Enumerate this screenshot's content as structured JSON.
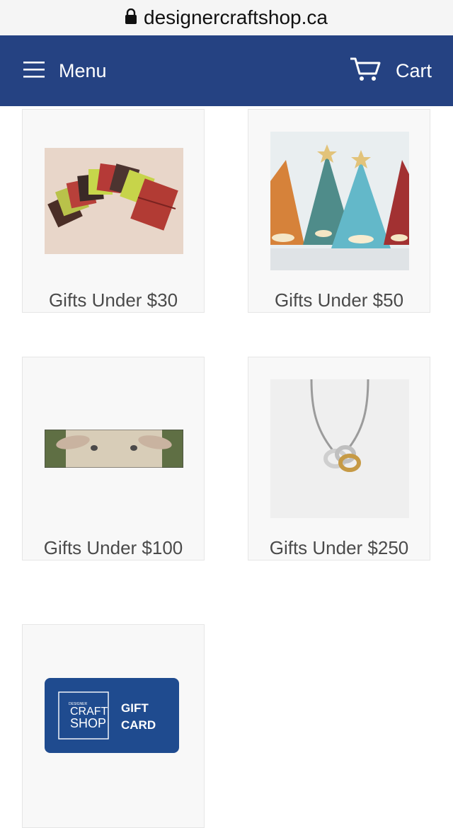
{
  "browser": {
    "url": "designercraftshop.ca"
  },
  "header": {
    "menu_label": "Menu",
    "cart_label": "Cart",
    "background": "#254282"
  },
  "collections": [
    {
      "title": "Gifts Under $30",
      "image": "leather-journals"
    },
    {
      "title": "Gifts Under $50",
      "image": "ceramic-tree-candle-holders"
    },
    {
      "title": "Gifts Under $100",
      "image": "sheep-face-banner"
    },
    {
      "title": "Gifts Under $250",
      "image": "silver-knot-necklace"
    },
    {
      "title": "Gift Card",
      "image": "gift-card"
    }
  ],
  "gift_card": {
    "logo_small": "DESIGNER",
    "logo_line1": "CRAFT",
    "logo_line2": "SHOP",
    "text_line1": "GIFT",
    "text_line2": "CARD"
  }
}
